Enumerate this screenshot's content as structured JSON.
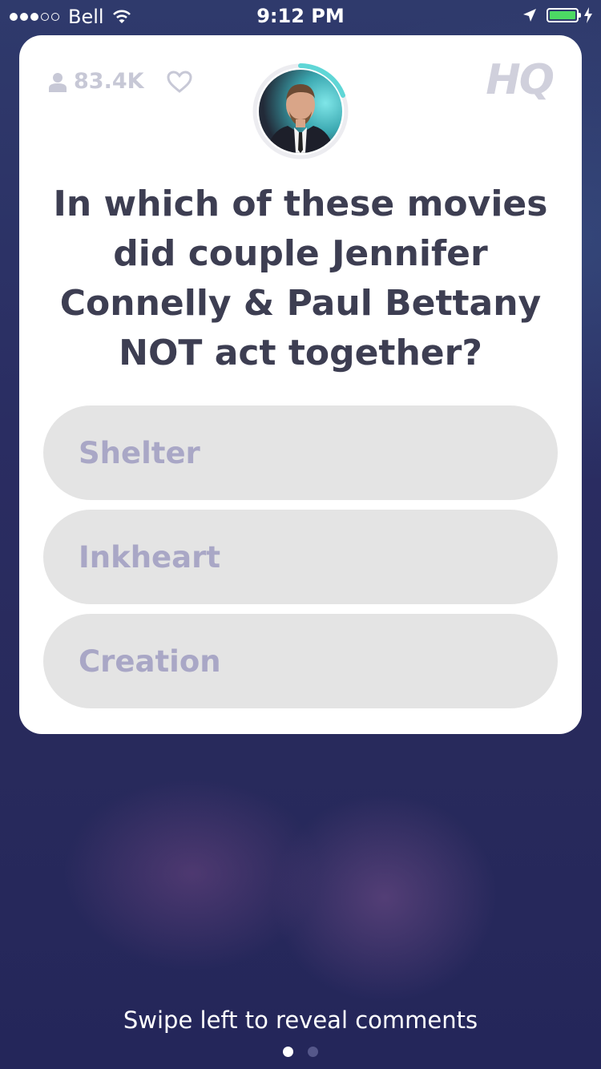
{
  "status_bar": {
    "carrier": "Bell",
    "time": "9:12 PM",
    "signal_bars_filled": 3,
    "signal_bars_total": 5,
    "battery_level": 1.0,
    "battery_color": "#4cd964"
  },
  "header": {
    "viewer_count": "83.4K",
    "viewer_icon": "person-icon",
    "like_icon": "heart-icon",
    "logo_text": "HQ",
    "host_avatar": "host-avatar",
    "timer_color": "#5fd6d6"
  },
  "question": {
    "text": "In which of these movies did couple Jennifer Connelly & Paul Bettany NOT act together?"
  },
  "answers": [
    {
      "label": "Shelter"
    },
    {
      "label": "Inkheart"
    },
    {
      "label": "Creation"
    }
  ],
  "footer": {
    "hint": "Swipe left to reveal comments",
    "page_index": 1,
    "page_count": 2
  },
  "colors": {
    "card_bg": "#ffffff",
    "answer_bg": "#e4e4e4",
    "answer_text": "#a9a7c6",
    "question_text": "#3d3e52"
  }
}
